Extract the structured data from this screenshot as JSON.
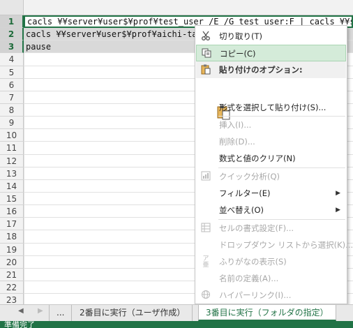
{
  "grid": {
    "row_numbers": [
      "1",
      "2",
      "3",
      "4",
      "5",
      "6",
      "7",
      "8",
      "9",
      "10",
      "11",
      "12",
      "13",
      "14",
      "15",
      "16",
      "17",
      "18",
      "19",
      "20",
      "21",
      "22",
      "23"
    ],
    "rows": [
      "cacls ¥¥server¥user$¥prof¥test_user /E /G test_user:F | cacls ¥¥server¥user$¥",
      "cacls ¥¥server¥user$¥prof¥aichi-taro",
      "pause"
    ]
  },
  "context_menu": {
    "items": [
      {
        "label": "切り取り(T)",
        "icon": "scissors-icon",
        "state": "normal"
      },
      {
        "label": "コピー(C)",
        "icon": "copy-icon",
        "state": "highlighted"
      },
      {
        "label": "貼り付けのオプション:",
        "icon": "paste-icon",
        "state": "header"
      },
      {
        "label": "形式を選択して貼り付け(S)...",
        "icon": "",
        "state": "normal"
      },
      {
        "label": "挿入(I)...",
        "icon": "",
        "state": "disabled"
      },
      {
        "label": "削除(D)...",
        "icon": "",
        "state": "disabled"
      },
      {
        "label": "数式と値のクリア(N)",
        "icon": "",
        "state": "normal"
      },
      {
        "label": "クイック分析(Q)",
        "icon": "quick-analysis-icon",
        "state": "disabled"
      },
      {
        "label": "フィルター(E)",
        "icon": "",
        "state": "normal",
        "submenu": true
      },
      {
        "label": "並べ替え(O)",
        "icon": "",
        "state": "normal",
        "submenu": true
      },
      {
        "label": "セルの書式設定(F)...",
        "icon": "format-cells-icon",
        "state": "disabled"
      },
      {
        "label": "ドロップダウン リストから選択(K)...",
        "icon": "",
        "state": "disabled"
      },
      {
        "label": "ふりがなの表示(S)",
        "icon": "furigana-icon",
        "state": "disabled"
      },
      {
        "label": "名前の定義(A)...",
        "icon": "",
        "state": "disabled"
      },
      {
        "label": "ハイパーリンク(I)...",
        "icon": "hyperlink-icon",
        "state": "disabled"
      }
    ]
  },
  "sheet_tabs": {
    "ellipsis": "...",
    "tabs": [
      "2番目に実行（ユーザ作成）",
      "3番目に実行（フォルダの指定）"
    ],
    "active_index": 1
  },
  "status": {
    "text": "準備完了"
  },
  "colors": {
    "accent": "#217346",
    "highlight": "#d4ebd9",
    "selection": "#d9d9d9"
  }
}
